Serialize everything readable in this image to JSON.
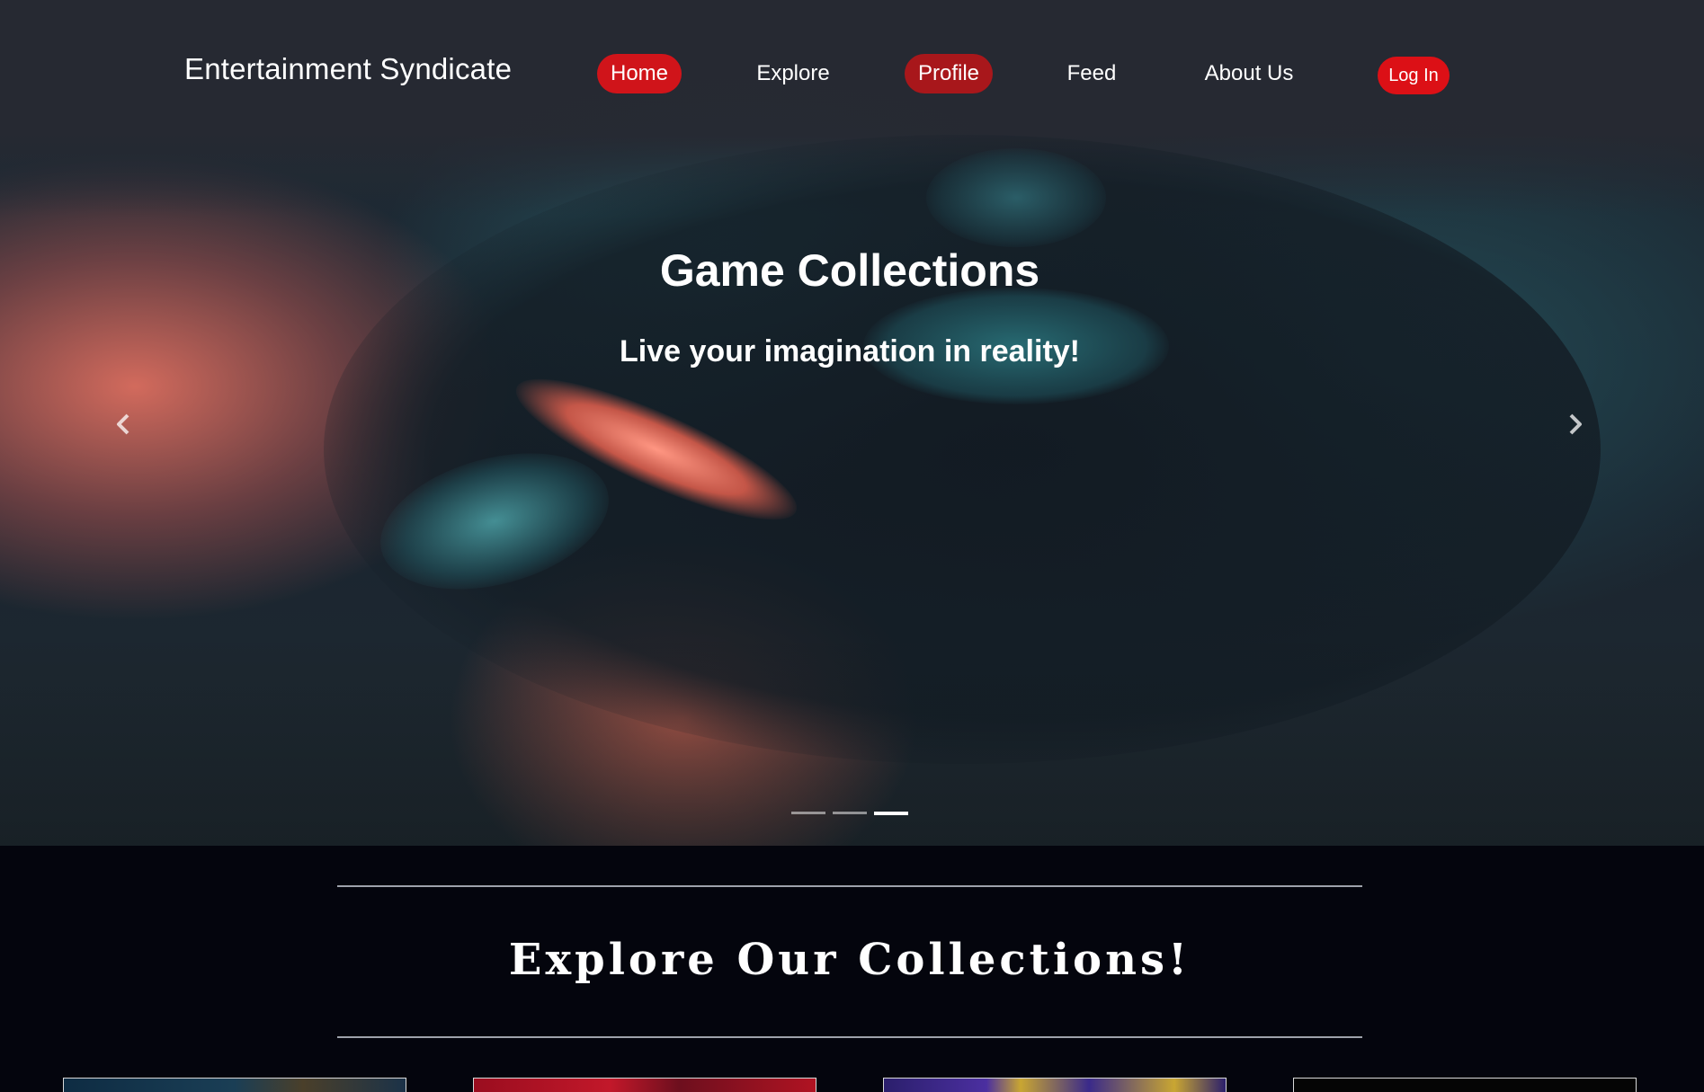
{
  "nav": {
    "brand": "Entertainment Syndicate",
    "items": [
      {
        "label": "Home"
      },
      {
        "label": "Explore"
      },
      {
        "label": "Profile"
      },
      {
        "label": "Feed"
      },
      {
        "label": "About Us"
      }
    ],
    "login_label": "Log In"
  },
  "hero": {
    "title": "Game Collections",
    "subtitle": "Live your imagination in reality!",
    "prev_icon": "chevron-left-icon",
    "next_icon": "chevron-right-icon",
    "slide_count": 3,
    "active_slide": 3
  },
  "explore": {
    "heading": "Explore Our Collections!",
    "cards_visible": 4
  },
  "colors": {
    "accent": "#d0141a",
    "page_background": "#04050d",
    "nav_background": "#262932"
  }
}
